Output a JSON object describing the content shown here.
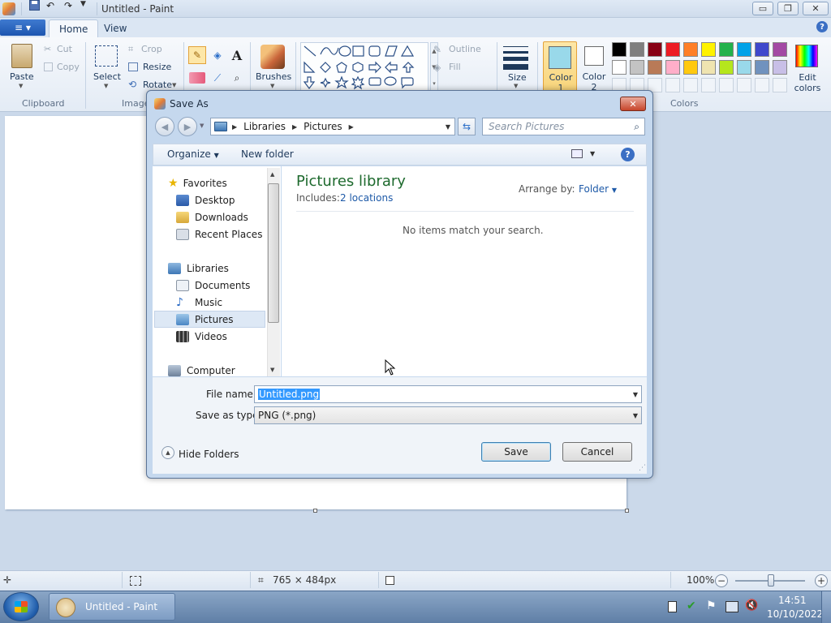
{
  "window": {
    "title": "Untitled - Paint",
    "controls": {
      "minimize": "▭",
      "restore": "❐",
      "close": "✕"
    }
  },
  "ribbon": {
    "app_menu_icon": "≡",
    "tabs": [
      "Home",
      "View"
    ],
    "clipboard": {
      "paste": "Paste",
      "cut": "Cut",
      "copy": "Copy",
      "group": "Clipboard"
    },
    "image": {
      "select": "Select",
      "crop": "Crop",
      "resize": "Resize",
      "rotate": "Rotate",
      "group": "Image"
    },
    "tools": {
      "brushes": "Brushes"
    },
    "shapes": {
      "outline": "Outline",
      "fill": "Fill"
    },
    "size": {
      "label": "Size"
    },
    "colors": {
      "color1": "Color 1",
      "color2": "Color 2",
      "edit": "Edit colors",
      "group": "Colors",
      "palette_row1": [
        "#000000",
        "#7f7f7f",
        "#880015",
        "#ed1c24",
        "#ff7f27",
        "#fff200",
        "#22b14c",
        "#00a2e8",
        "#3f48cc",
        "#a349a4"
      ],
      "palette_row2": [
        "#ffffff",
        "#c3c3c3",
        "#b97a57",
        "#ffaec9",
        "#ffc90e",
        "#efe4b0",
        "#b5e61d",
        "#99d9ea",
        "#7092be",
        "#c8bfe7"
      ]
    }
  },
  "dialog": {
    "title": "Save As",
    "breadcrumb": [
      "Libraries",
      "Pictures"
    ],
    "search_placeholder": "Search Pictures",
    "toolbar": {
      "organize": "Organize",
      "new_folder": "New folder"
    },
    "nav": {
      "favorites": "Favorites",
      "favorites_items": [
        "Desktop",
        "Downloads",
        "Recent Places"
      ],
      "libraries": "Libraries",
      "libraries_items": [
        "Documents",
        "Music",
        "Pictures",
        "Videos"
      ],
      "computer": "Computer",
      "selected": "Pictures"
    },
    "library_title": "Pictures library",
    "includes_label": "Includes:",
    "includes_link": "2 locations",
    "arrange_label": "Arrange by:",
    "arrange_value": "Folder",
    "empty_message": "No items match your search.",
    "file_name_label": "File name:",
    "file_name_value": "Untitled.png",
    "save_type_label": "Save as type:",
    "save_type_value": "PNG (*.png)",
    "hide_folders": "Hide Folders",
    "save_button": "Save",
    "cancel_button": "Cancel"
  },
  "statusbar": {
    "dimensions": "765 × 484px",
    "zoom": "100%"
  },
  "taskbar": {
    "task_label": "Untitled - Paint",
    "time": "14:51",
    "date": "10/10/2022"
  }
}
